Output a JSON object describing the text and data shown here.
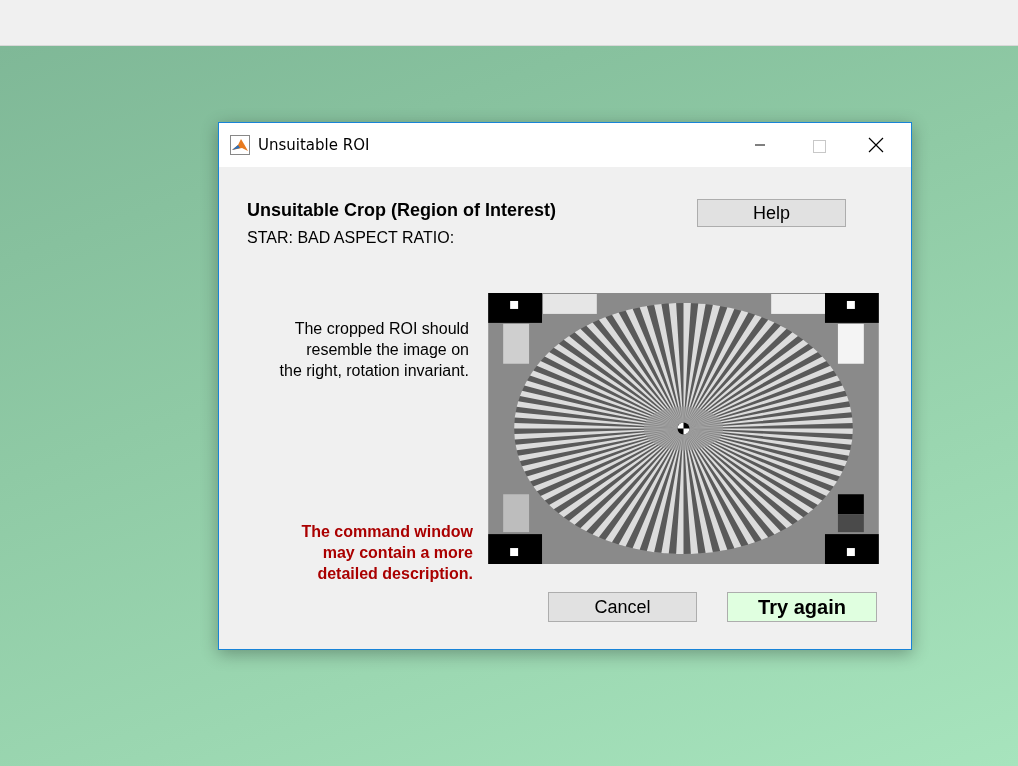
{
  "window": {
    "title": "Unsuitable ROI"
  },
  "dialog": {
    "heading": "Unsuitable Crop (Region of Interest)",
    "subheading": "STAR: BAD ASPECT RATIO:",
    "help_button": "Help",
    "description": "The cropped ROI should\nresemble the image on\nthe right, rotation invariant.",
    "note": "The command window\nmay contain a more\ndetailed description.",
    "buttons": [
      {
        "label": "Cancel",
        "kind": "normal"
      },
      {
        "label": "Try again",
        "kind": "primary"
      }
    ]
  }
}
